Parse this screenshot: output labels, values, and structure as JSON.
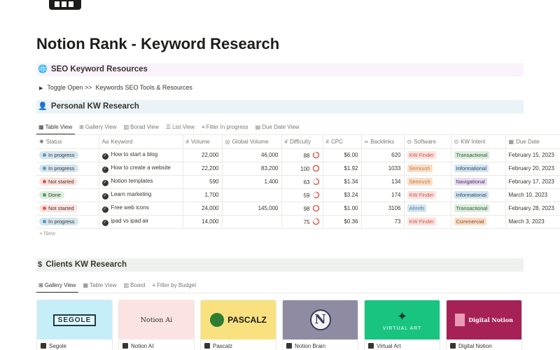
{
  "page": {
    "title": "Notion Rank - Keyword Research"
  },
  "callouts": {
    "seo_resources": {
      "emoji": "🌐",
      "label": "SEO Keyword Resources",
      "bg": "#fbf3fb"
    },
    "personal_kw": {
      "emoji": "👤",
      "label": "Personal KW Research",
      "bg": "#e9f3f8"
    },
    "clients_kw": {
      "emoji": "$",
      "label": "Clients KW Research",
      "bg": "#edf3ec"
    }
  },
  "toggle": {
    "label": "Toggle Open >>  Keywords SEO Tools & Resources"
  },
  "personal_views": [
    {
      "icon": "table-icon",
      "label": "Table View",
      "active": true
    },
    {
      "icon": "gallery-icon",
      "label": "Gallery View"
    },
    {
      "icon": "board-icon",
      "label": "Borad View"
    },
    {
      "icon": "list-icon",
      "label": "List View"
    },
    {
      "icon": "filter-icon",
      "label": "Filter In progress"
    },
    {
      "icon": "calendar-icon",
      "label": "Due Date View"
    }
  ],
  "table": {
    "columns": [
      "Status",
      "Keyword",
      "Volume",
      "Global Volume",
      "Difficulty",
      "CPC",
      "Backlinks",
      "Software",
      "KW Intent",
      "Due Date"
    ],
    "rows": [
      {
        "status": "In progress",
        "keyword": "How to start a blog",
        "volume": "22,000",
        "global_volume": "46,000",
        "difficulty": "88",
        "difficulty_pct": 88,
        "cpc": "$6.00",
        "backlinks": "620",
        "software": "KW Finder",
        "intent": "Transactional",
        "due": "February 15, 2023"
      },
      {
        "status": "In progress",
        "keyword": "How to create a website",
        "volume": "22,200",
        "global_volume": "83,200",
        "difficulty": "100",
        "difficulty_pct": 100,
        "cpc": "$1.92",
        "backlinks": "1033",
        "software": "Semrush",
        "intent": "Informational",
        "due": "February 20, 2023"
      },
      {
        "status": "Not started",
        "keyword": "Notion templates",
        "volume": "590",
        "global_volume": "1,400",
        "difficulty": "63",
        "difficulty_pct": 63,
        "cpc": "$1.34",
        "backlinks": "134",
        "software": "Semrush",
        "intent": "Navigational",
        "due": "February 17, 2023"
      },
      {
        "status": "Done",
        "keyword": "Learn marketing",
        "volume": "1,700",
        "global_volume": "",
        "difficulty": "59",
        "difficulty_pct": 59,
        "cpc": "$3.24",
        "backlinks": "174",
        "software": "KW Finder",
        "intent": "Informational",
        "due": "March 10, 2023"
      },
      {
        "status": "Not started",
        "keyword": "Free web icons",
        "volume": "24,000",
        "global_volume": "145,000",
        "difficulty": "98",
        "difficulty_pct": 98,
        "cpc": "$1.00",
        "backlinks": "3106",
        "software": "Ahrefs",
        "intent": "Transactional",
        "due": "February 28, 2023"
      },
      {
        "status": "In progress",
        "keyword": "ipad vs ipad air",
        "volume": "14,000",
        "global_volume": "",
        "difficulty": "75",
        "difficulty_pct": 75,
        "cpc": "$0.36",
        "backlinks": "73",
        "software": "KW Finder",
        "intent": "Commercial",
        "due": "March 3, 2023"
      }
    ],
    "new_label": "+ New"
  },
  "status_styles": {
    "In progress": {
      "bg": "#d3e5ef",
      "dot": "#5b97bd"
    },
    "Not started": {
      "bg": "#ffe2dd",
      "dot": "#df5452"
    },
    "Done": {
      "bg": "#dbeddb",
      "dot": "#4f9768"
    }
  },
  "software_colors": {
    "KW Finder": {
      "bg": "#ffe2dd",
      "fg": "#c4554d"
    },
    "Semrush": {
      "bg": "#fadec9",
      "fg": "#c47a35"
    },
    "Ahrefs": {
      "bg": "#d3e5ef",
      "fg": "#487ca5"
    }
  },
  "intent_colors": {
    "Transactional": {
      "bg": "#dbeddb",
      "fg": "#2b593f"
    },
    "Informational": {
      "bg": "#d3e5ef",
      "fg": "#28456c"
    },
    "Navigational": {
      "bg": "#e8deee",
      "fg": "#492f64"
    },
    "Commercial": {
      "bg": "#fadec9",
      "fg": "#854c1d"
    }
  },
  "difficulty_color": "#e16259",
  "client_views": [
    {
      "icon": "gallery-icon",
      "label": "Gallery View",
      "active": true
    },
    {
      "icon": "table-icon",
      "label": "Table View"
    },
    {
      "icon": "board-icon",
      "label": "Board"
    },
    {
      "icon": "filter-icon",
      "label": "Filter by Budget"
    }
  ],
  "cards": [
    {
      "name": "Segole",
      "cover_text": "SEGOLE",
      "cover_bg": "#c6eef9"
    },
    {
      "name": "Notion AI",
      "cover_text": "Notion Ai",
      "cover_bg": "#fce3e3"
    },
    {
      "name": "Pascalz",
      "cover_text": "PASCALZ",
      "cover_bg": "#f9e17f"
    },
    {
      "name": "Notion Brain",
      "cover_text": "N",
      "cover_bg": "#8e8ba2"
    },
    {
      "name": "Virtual Art",
      "cover_text": "VIRTUAL ART",
      "cover_bg": "#19c481"
    },
    {
      "name": "Digital Notion",
      "cover_text": "Digital Notion",
      "cover_bg": "#a62155"
    }
  ]
}
